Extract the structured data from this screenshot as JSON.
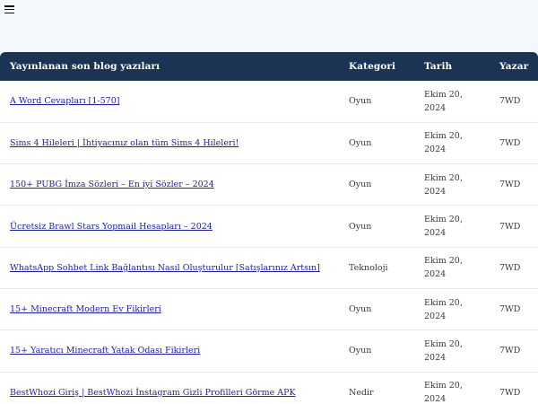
{
  "header": {
    "menu_icon": "hamburger-menu-icon"
  },
  "table": {
    "columns": [
      "Yayınlanan son blog yazıları",
      "Kategori",
      "Tarih",
      "Yazar"
    ],
    "rows": [
      {
        "title": "A Word Cevapları [1-570]",
        "category": "Oyun",
        "date_line1": "Ekim 20,",
        "date_line2": "2024",
        "author": "7WD"
      },
      {
        "title": "Sims 4 Hileleri | İhtiyacınız olan tüm Sims 4 Hileleri!",
        "category": "Oyun",
        "date_line1": "Ekim 20,",
        "date_line2": "2024",
        "author": "7WD"
      },
      {
        "title": "150+ PUBG İmza Sözleri – En iyi Sözler – 2024",
        "category": "Oyun",
        "date_line1": "Ekim 20,",
        "date_line2": "2024",
        "author": "7WD"
      },
      {
        "title": "Ücretsiz Brawl Stars Yopmail Hesapları – 2024",
        "category": "Oyun",
        "date_line1": "Ekim 20,",
        "date_line2": "2024",
        "author": "7WD"
      },
      {
        "title": "WhatsApp Sohbet Link Bağlantısı Nasıl Oluşturulur [Satışlarınız Artsın]",
        "category": "Teknoloji",
        "date_line1": "Ekim 20,",
        "date_line2": "2024",
        "author": "7WD"
      },
      {
        "title": "15+ Minecraft Modern Ev Fikirleri",
        "category": "Oyun",
        "date_line1": "Ekim 20,",
        "date_line2": "2024",
        "author": "7WD"
      },
      {
        "title": "15+ Yaratıcı Minecraft Yatak Odası Fikirleri",
        "category": "Oyun",
        "date_line1": "Ekim 20,",
        "date_line2": "2024",
        "author": "7WD"
      },
      {
        "title": "BestWhozi Giriş | BestWhozi İnstagram Gizli Profilleri Görme APK",
        "category": "Nedir",
        "date_line1": "Ekim 20,",
        "date_line2": "2024",
        "author": "7WD"
      }
    ]
  }
}
